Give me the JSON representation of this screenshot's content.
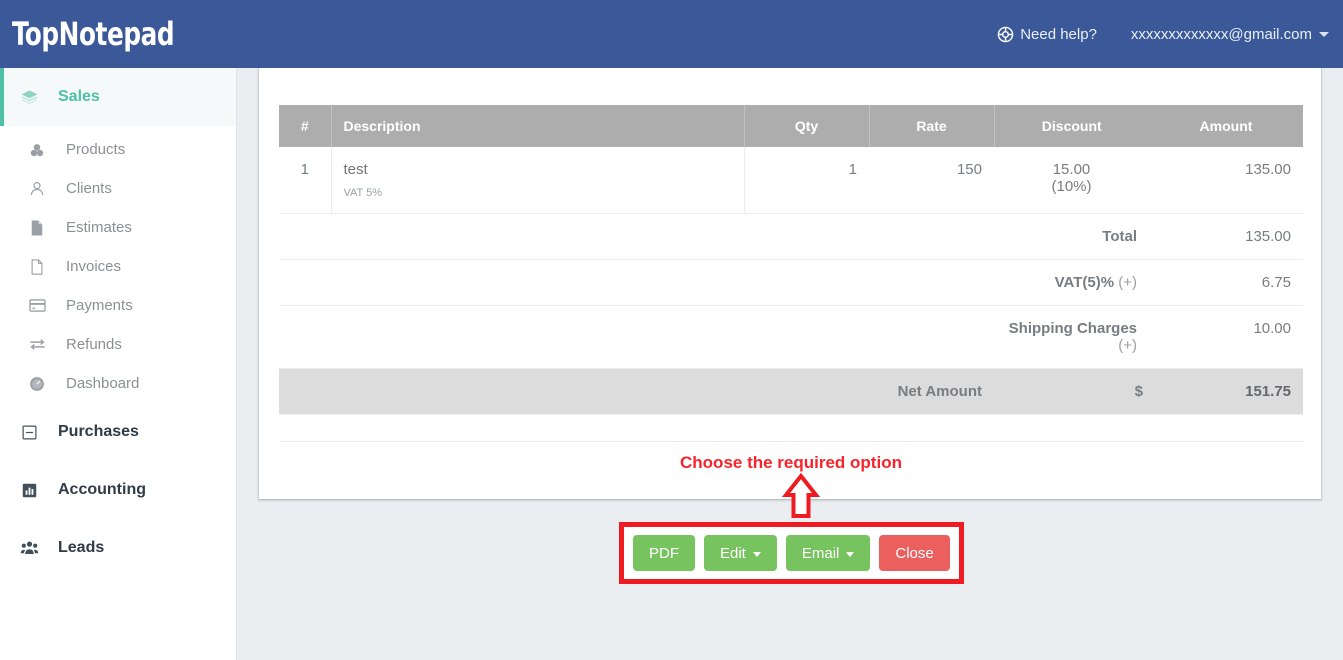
{
  "brand": {
    "text": "TopNotepad"
  },
  "navbar": {
    "help_label": "Need help?",
    "help_icon": "lifebuoy-icon",
    "account_email": "xxxxxxxxxxxxx@gmail.com"
  },
  "sidebar": {
    "items": [
      {
        "label": "Sales",
        "icon": "layers-icon",
        "type": "group",
        "active": true
      },
      {
        "label": "Products",
        "icon": "cubes-icon",
        "type": "sub"
      },
      {
        "label": "Clients",
        "icon": "user-icon",
        "type": "sub"
      },
      {
        "label": "Estimates",
        "icon": "document-filled-icon",
        "type": "sub"
      },
      {
        "label": "Invoices",
        "icon": "document-outline-icon",
        "type": "sub"
      },
      {
        "label": "Payments",
        "icon": "credit-card-icon",
        "type": "sub"
      },
      {
        "label": "Refunds",
        "icon": "exchange-icon",
        "type": "sub"
      },
      {
        "label": "Dashboard",
        "icon": "speedometer-icon",
        "type": "sub"
      },
      {
        "label": "Purchases",
        "icon": "minus-box-icon",
        "type": "group"
      },
      {
        "label": "Accounting",
        "icon": "bar-chart-icon",
        "type": "group"
      },
      {
        "label": "Leads",
        "icon": "people-icon",
        "type": "group"
      }
    ]
  },
  "invoice": {
    "columns": [
      "#",
      "Description",
      "Qty",
      "Rate",
      "Discount",
      "Amount"
    ],
    "rows": [
      {
        "num": "1",
        "description": "test",
        "description_sub": "VAT 5%",
        "qty": "1",
        "rate": "150",
        "discount": "15.00",
        "discount_pct": "(10%)",
        "amount": "135.00"
      }
    ],
    "totals": [
      {
        "label": "Total",
        "suffix": "",
        "currency": "",
        "value": "135.00",
        "highlight": false
      },
      {
        "label": "VAT(5)%",
        "suffix": "(+)",
        "currency": "",
        "value": "6.75",
        "highlight": false
      },
      {
        "label": "Shipping Charges",
        "suffix": "(+)",
        "currency": "",
        "value": "10.00",
        "highlight": false
      },
      {
        "label": "Net Amount",
        "suffix": "",
        "currency": "$",
        "value": "151.75",
        "highlight": true
      }
    ]
  },
  "annotation": {
    "text": "Choose the required option",
    "text_color": "#f8232b",
    "arrow_icon": "up-arrow-outline-icon",
    "highlight_color": "#ee1c22"
  },
  "actions": {
    "buttons": [
      {
        "label": "PDF",
        "style": "green",
        "has_caret": false
      },
      {
        "label": "Edit",
        "style": "green",
        "has_caret": true
      },
      {
        "label": "Email",
        "style": "green",
        "has_caret": true
      },
      {
        "label": "Close",
        "style": "red",
        "has_caret": false
      }
    ]
  },
  "colors": {
    "navbar": "#3b5998",
    "accent_green": "#4ec1a5",
    "button_green": "#77c360",
    "button_red": "#ec5f5f",
    "table_header": "#adadad",
    "net_amount_row": "#dcdcdc",
    "content_bg": "#eaeef0"
  }
}
